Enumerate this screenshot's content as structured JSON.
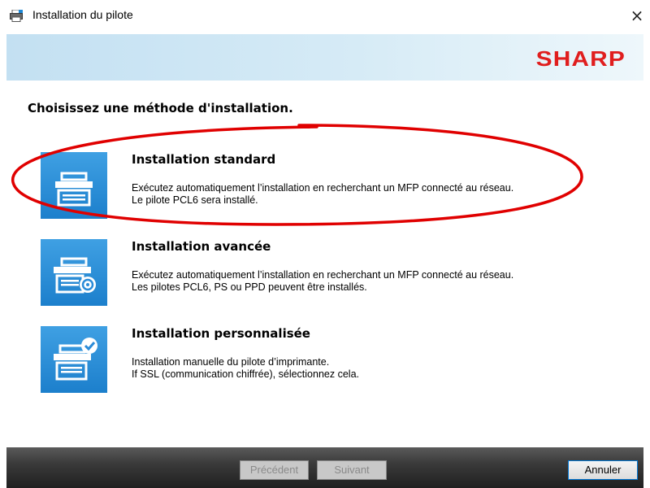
{
  "window": {
    "title": "Installation du pilote",
    "close_glyph": "×"
  },
  "banner": {
    "logo_text": "SHARP",
    "logo_color": "#e01e1e"
  },
  "heading": "Choisissez une méthode d'installation.",
  "options": [
    {
      "title": "Installation standard",
      "desc_line1": "Exécutez automatiquement l’installation en recherchant un MFP connecté au réseau.",
      "desc_line2": "Le pilote PCL6 sera installé.",
      "icon": "printer-icon",
      "highlighted": true
    },
    {
      "title": "Installation avancée",
      "desc_line1": "Exécutez automatiquement l’installation en recherchant un MFP connecté au réseau.",
      "desc_line2": "Les pilotes PCL6, PS ou PPD peuvent être installés.",
      "icon": "printer-settings-icon",
      "highlighted": false
    },
    {
      "title": "Installation personnalisée",
      "desc_line1": "Installation manuelle du pilote d’imprimante.",
      "desc_line2": "If SSL (communication chiffrée), sélectionnez cela.",
      "icon": "printer-check-icon",
      "highlighted": false
    }
  ],
  "footer": {
    "back_label": "Précédent",
    "next_label": "Suivant",
    "cancel_label": "Annuler",
    "back_enabled": false,
    "next_enabled": false,
    "cancel_enabled": true
  },
  "colors": {
    "icon_blue": "#2a8bd8",
    "highlight_red": "#e00000"
  }
}
